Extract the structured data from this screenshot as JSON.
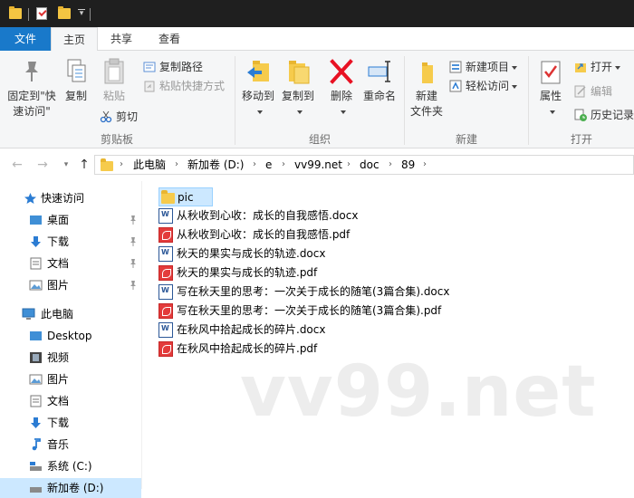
{
  "ribbon_tabs": {
    "file": "文件",
    "home": "主页",
    "share": "共享",
    "view": "查看"
  },
  "clipboard": {
    "pin_label_line1": "固定到\"快",
    "pin_label_line2": "速访问\"",
    "copy": "复制",
    "paste": "粘贴",
    "copy_path": "复制路径",
    "paste_shortcut": "粘贴快捷方式",
    "cut": "剪切",
    "group_label": "剪贴板"
  },
  "organize": {
    "move_to": "移动到",
    "copy_to": "复制到",
    "delete": "删除",
    "rename": "重命名",
    "group_label": "组织"
  },
  "new": {
    "new_folder_line1": "新建",
    "new_folder_line2": "文件夹",
    "new_item": "新建项目",
    "easy_access": "轻松访问",
    "group_label": "新建"
  },
  "open": {
    "properties": "属性",
    "open": "打开",
    "edit": "编辑",
    "history": "历史记录",
    "group_label": "打开"
  },
  "breadcrumbs": [
    "此电脑",
    "新加卷 (D:)",
    "e",
    "vv99.net",
    "doc",
    "89"
  ],
  "nav_pane": {
    "quick_access": "快速访问",
    "quick_items": [
      "桌面",
      "下载",
      "文档",
      "图片"
    ],
    "this_pc": "此电脑",
    "pc_items": [
      "Desktop",
      "视频",
      "图片",
      "文档",
      "下载",
      "音乐",
      "系统 (C:)",
      "新加卷 (D:)"
    ]
  },
  "files": [
    {
      "name": "pic",
      "type": "folder"
    },
    {
      "name": "从秋收到心收：成长的自我感悟.docx",
      "type": "docx"
    },
    {
      "name": "从秋收到心收：成长的自我感悟.pdf",
      "type": "pdf"
    },
    {
      "name": "秋天的果实与成长的轨迹.docx",
      "type": "docx"
    },
    {
      "name": "秋天的果实与成长的轨迹.pdf",
      "type": "pdf"
    },
    {
      "name": "写在秋天里的思考：一次关于成长的随笔(3篇合集).docx",
      "type": "docx"
    },
    {
      "name": "写在秋天里的思考：一次关于成长的随笔(3篇合集).pdf",
      "type": "pdf"
    },
    {
      "name": "在秋风中拾起成长的碎片.docx",
      "type": "docx"
    },
    {
      "name": "在秋风中拾起成长的碎片.pdf",
      "type": "pdf"
    }
  ],
  "watermark": "vv99.net",
  "colors": {
    "accent": "#1979ca",
    "selection": "#cce8ff",
    "folder": "#f6cb4c",
    "delete": "#e81123"
  }
}
